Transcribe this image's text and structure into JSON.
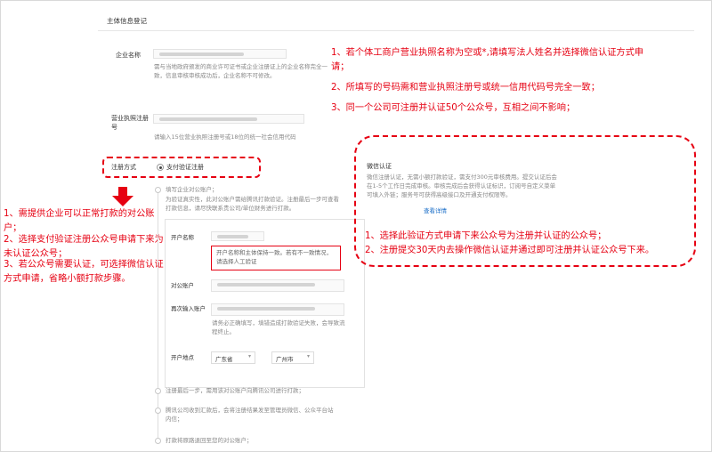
{
  "section": {
    "title": "主体信息登记"
  },
  "enterprise_name": {
    "label": "企业名称",
    "hint": "需与当地政府颁发的商业许可证书或企业注册证上的企业名称完全一致，信息审核审核成功后，企业名称不可修改。"
  },
  "license_number": {
    "label": "营业执照注册号",
    "hint": "请输入15位营业执照注册号或18位的统一社会信用代码"
  },
  "registration_method": {
    "label": "注册方式",
    "option": "支付验证注册"
  },
  "steps": [
    {
      "text": "填写企业对公账户；"
    },
    {
      "text": "为验证真实性，此对公账户需给腾讯打款验证。注册最后一步可查看打款信息，请尽快联系贵公司/单位财务进行打款。"
    },
    {
      "text": "注册最后一步，需用该对公账户向腾讯公司进行打款；"
    },
    {
      "text": "腾讯公司收到汇款后，会将注册结果发至管理员微信、公众平台站内信；"
    },
    {
      "text": "打款将原路退回至您的对公账户；"
    }
  ],
  "account_form": {
    "account_name_label": "开户名称",
    "account_name_tip": "开户名称和主体保持一致。若有不一致情况，请选择人工验证",
    "account_label": "对公账户",
    "reenter_label": "再次输入账户",
    "reenter_hint": "请务必正确填写，填错造成打款验证失败，会导致流程终止。",
    "location_label": "开户地点",
    "province": "广东省",
    "city": "广州市"
  },
  "wechat_cert": {
    "title": "微信认证",
    "body": "微信注册认证，无需小额打款验证，需支付300元审核费用。提交认证后会在1-5个工作日完成审核。审核完成后会获得认证标识，订阅号自定义菜单可填入外链；服务号可获得高级接口及开通支付权限等。",
    "link": "查看详情"
  },
  "annotations": {
    "top": [
      "1、若个体工商户营业执照名称为空或*,请填写法人姓名并选择微信认证方式申请；",
      "2、所填写的号码需和营业执照注册号或统一信用代码号完全一致；",
      "3、同一个公司可注册并认证50个公众号，互相之间不影响；"
    ],
    "left": [
      "1、需提供企业可以正常打款的对公账户；",
      "2、选择支付验证注册公众号申请下来为未认证公众号；",
      "3、若公众号需要认证，可选择微信认证方式申请，省略小额打款步骤。"
    ],
    "right": [
      "1、选择此验证方式申请下来公众号为注册并认证的公众号；",
      "2、注册提交30天内去操作微信认证并通过即可注册并认证公众号下来。"
    ]
  },
  "colors": {
    "annotation_red": "#e60012",
    "link_blue": "#1a6ec8"
  }
}
